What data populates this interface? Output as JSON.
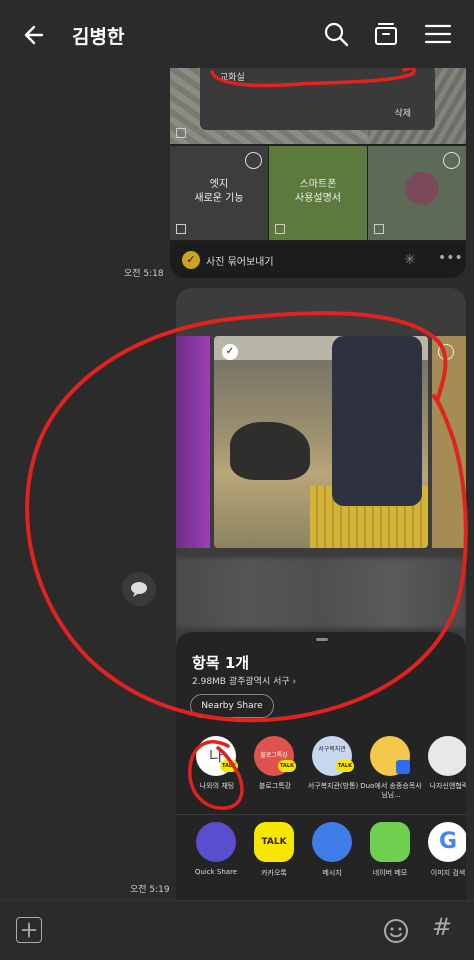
{
  "header": {
    "title": "김병한",
    "back_icon": "arrow-left-icon",
    "icons": [
      "search-icon",
      "drawer-icon",
      "menu-icon"
    ]
  },
  "message1": {
    "popup_label": "교화실",
    "popup_delete": "삭제",
    "tile_edge": "엣지\n새로운 기능",
    "tile_manual": "스마트폰\n사용설명서",
    "bundle_label": "사진 묶어보내기",
    "time": "오전 5:18"
  },
  "message2": {
    "time": "오전 5:19"
  },
  "share_sheet": {
    "item_count": "항목 1개",
    "meta": "2.98MB 광주광역시 ",
    "meta_place": "서구",
    "nearby_share": "Nearby Share",
    "contacts": [
      {
        "label": "나와의 채팅",
        "avatar_text": "나",
        "color": "#ffffff"
      },
      {
        "label": "블로그특강",
        "avatar_text": "블로그특강",
        "color": "#e0524f"
      },
      {
        "label": "서구복지관(방통)",
        "avatar_text": "서구복지관",
        "color": "#c7d7f0"
      },
      {
        "label": "Duo에서 송종승목사님님...",
        "avatar_text": "",
        "color": "#f2c94c"
      },
      {
        "label": "나자신앤협력",
        "avatar_text": "",
        "color": "#e8e8e8"
      }
    ],
    "badge_text": "TALK",
    "apps": [
      {
        "label": "Quick Share",
        "color": "#5a4fcf"
      },
      {
        "label": "카카오톡",
        "color": "#f7e600"
      },
      {
        "label": "메시지",
        "color": "#3f7ee8"
      },
      {
        "label": "네이버 메모",
        "color": "#6fcf4f"
      },
      {
        "label": "이미지 검색",
        "color": "#ffffff"
      }
    ],
    "kakao_app_text": "TALK"
  },
  "bottom": {
    "icons": [
      "plus-icon",
      "emoji-icon",
      "hashtag-icon"
    ],
    "hash": "#"
  },
  "colors": {
    "background": "#2b2b2b",
    "annotation_red": "#e0231e",
    "kakao_yellow": "#f7e600"
  }
}
